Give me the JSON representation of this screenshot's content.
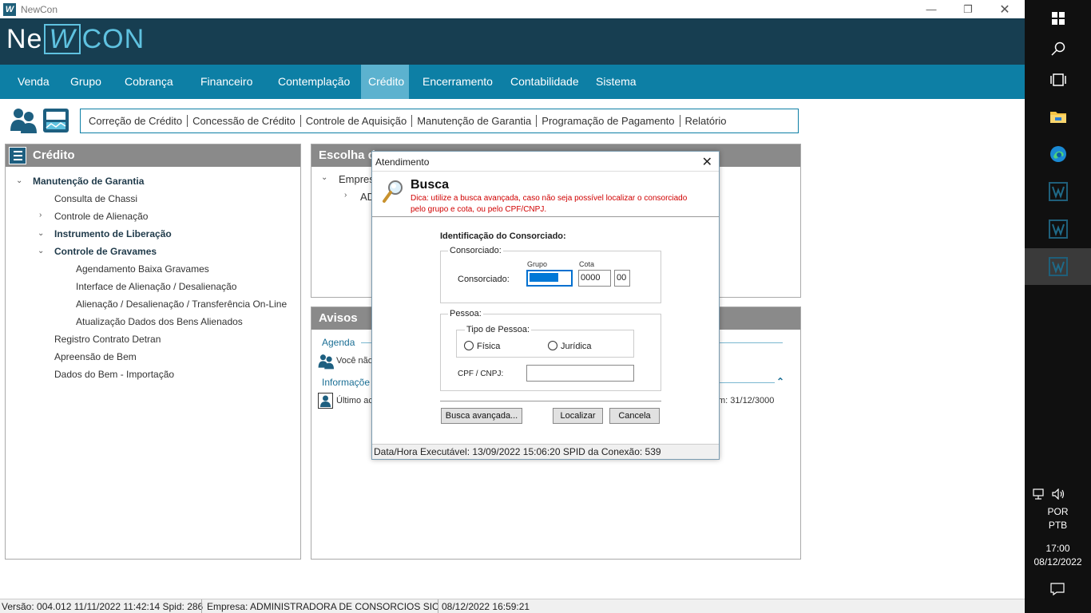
{
  "window": {
    "title": "NewCon",
    "logo_prefix": "Ne",
    "logo_w": "W",
    "logo_suffix": "CON"
  },
  "menu": [
    {
      "label": "Venda"
    },
    {
      "label": "Grupo"
    },
    {
      "label": "Cobrança"
    },
    {
      "label": "Financeiro"
    },
    {
      "label": "Contemplação"
    },
    {
      "label": "Crédito"
    },
    {
      "label": "Encerramento"
    },
    {
      "label": "Contabilidade"
    },
    {
      "label": "Sistema"
    }
  ],
  "menu_active": "Crédito",
  "submenu": [
    {
      "label": "Correção de Crédito"
    },
    {
      "label": "Concessão de Crédito"
    },
    {
      "label": "Controle de Aquisição"
    },
    {
      "label": "Manutenção de Garantia"
    },
    {
      "label": "Programação de Pagamento"
    },
    {
      "label": "Relatório"
    }
  ],
  "left_panel": {
    "title": "Crédito",
    "tree": [
      {
        "label": "Manutenção de Garantia"
      },
      {
        "label": "Consulta de Chassi"
      },
      {
        "label": "Controle de Alienação"
      },
      {
        "label": "Instrumento de Liberação"
      },
      {
        "label": "Controle de Gravames"
      },
      {
        "label": "Agendamento Baixa Gravames"
      },
      {
        "label": "Interface de Alienação / Desalienação"
      },
      {
        "label": "Alienação / Desalienação / Transferência On-Line"
      },
      {
        "label": "Atualização Dados dos Bens Alienados"
      },
      {
        "label": "Registro Contrato Detran"
      },
      {
        "label": "Apreensão de Bem"
      },
      {
        "label": "Dados do Bem - Importação"
      }
    ]
  },
  "escolha_panel": {
    "title": "Escolha d",
    "tree_root": "Empres",
    "tree_child": "AD"
  },
  "avisos_panel": {
    "title": "Avisos",
    "agenda_label": "Agenda",
    "agenda_text": "Você não",
    "info_label": "Informaçõe",
    "info_text": "Último ac",
    "info_right": "m: 31/12/3000"
  },
  "dialog": {
    "title": "Atendimento",
    "close": "✕",
    "heading": "Busca",
    "tip": "Dica: utilize a busca avançada, caso não seja possível localizar o consorciado pelo grupo e cota, ou pelo CPF/CNPJ.",
    "ident_label": "Identificação do Consorciado:",
    "consorciado_group": "Consorciado:",
    "grupo_label": "Grupo",
    "cota_label": "Cota",
    "consorciado_field_label": "Consorciado:",
    "grupo_value": "",
    "cota_value": "0000",
    "digito_value": "00",
    "pessoa_group": "Pessoa:",
    "tipo_pessoa_label": "Tipo de Pessoa:",
    "fisica_label": "Física",
    "juridica_label": "Jurídica",
    "cpf_label": "CPF / CNPJ:",
    "cpf_value": "",
    "busca_avancada": "Busca avançada...",
    "localizar": "Localizar",
    "cancelar": "Cancela",
    "status": "Data/Hora Executável: 13/09/2022  15:06:20 SPID da Conexão: 539"
  },
  "statusbar": {
    "versao": "Versão: 004.012  11/11/2022 11:42:14  Spid: 286",
    "empresa": "Empresa: ADMINISTRADORA DE CONSORCIOS SICRED",
    "datetime": "08/12/2022  16:59:21"
  },
  "taskbar": {
    "lang1": "POR",
    "lang2": "PTB",
    "time": "17:00",
    "date": "08/12/2022"
  }
}
